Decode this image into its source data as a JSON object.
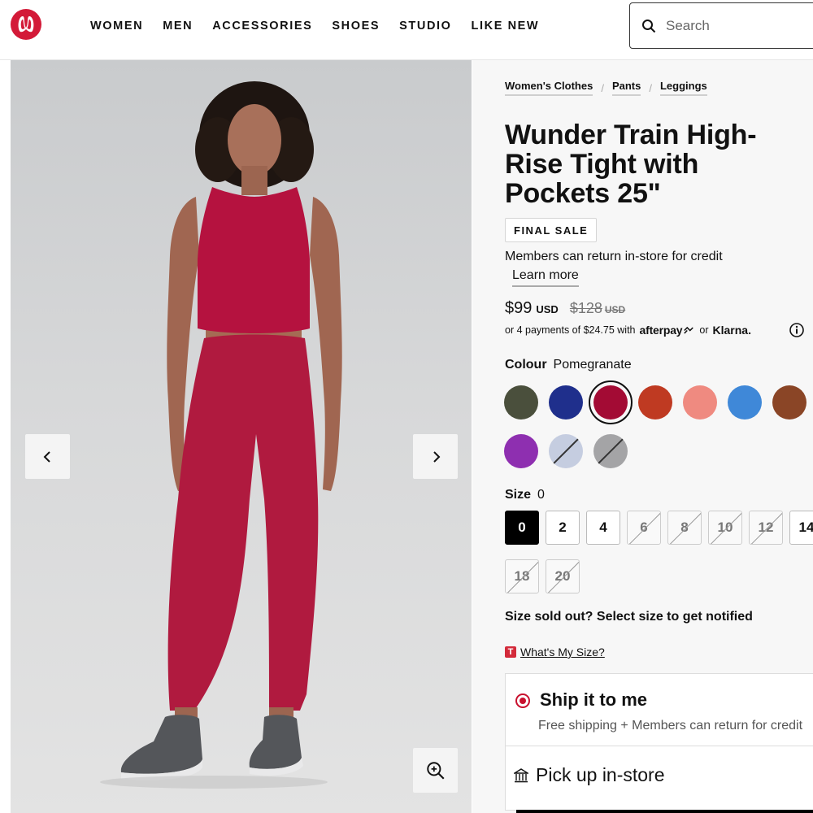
{
  "header": {
    "nav": [
      "WOMEN",
      "MEN",
      "ACCESSORIES",
      "SHOES",
      "STUDIO",
      "LIKE NEW"
    ],
    "search_placeholder": "Search"
  },
  "colors": {
    "brand": "#d31a38",
    "selected_size_bg": "#000000",
    "radio_accent": "#c8102e",
    "product": "#b3123e"
  },
  "product": {
    "breadcrumbs": [
      "Women's Clothes",
      "Pants",
      "Leggings"
    ],
    "title": "Wunder Train High-Rise Tight with Pockets 25\"",
    "badge": "FINAL SALE",
    "return_note": "Members can return in-store for credit",
    "learn_more": "Learn more",
    "price": "$99",
    "price_unit": "USD",
    "old_price": "$128",
    "old_price_unit": "USD",
    "installments_text": "or 4 payments of $24.75 with",
    "afterpay": "afterpay",
    "or_text": "or",
    "klarna": "Klarna."
  },
  "colour": {
    "label": "Colour",
    "selected": "Pomegranate",
    "swatches": [
      {
        "color": "#4a4f3c",
        "unavailable": false,
        "selected": false
      },
      {
        "color": "#1f2f8c",
        "unavailable": false,
        "selected": false
      },
      {
        "color": "#a30b34",
        "unavailable": false,
        "selected": true
      },
      {
        "color": "#bf3a22",
        "unavailable": false,
        "selected": false
      },
      {
        "color": "#ef8a80",
        "unavailable": false,
        "selected": false
      },
      {
        "color": "#3f88d8",
        "unavailable": false,
        "selected": false
      },
      {
        "color": "#8a4526",
        "unavailable": false,
        "selected": false
      },
      {
        "color": "#8e2fb0",
        "unavailable": false,
        "selected": false
      },
      {
        "color": "#c5cde0",
        "unavailable": true,
        "selected": false
      },
      {
        "color": "#a4a4a6",
        "unavailable": true,
        "selected": false
      }
    ]
  },
  "size": {
    "label": "Size",
    "selected": "0",
    "options": [
      {
        "label": "0",
        "sold_out": false,
        "selected": true
      },
      {
        "label": "2",
        "sold_out": false,
        "selected": false
      },
      {
        "label": "4",
        "sold_out": false,
        "selected": false
      },
      {
        "label": "6",
        "sold_out": true,
        "selected": false
      },
      {
        "label": "8",
        "sold_out": true,
        "selected": false
      },
      {
        "label": "10",
        "sold_out": true,
        "selected": false
      },
      {
        "label": "12",
        "sold_out": true,
        "selected": false
      },
      {
        "label": "14",
        "sold_out": false,
        "selected": false
      },
      {
        "label": "18",
        "sold_out": true,
        "selected": false
      },
      {
        "label": "20",
        "sold_out": true,
        "selected": false
      }
    ],
    "sold_out_note": "Size sold out? Select size to get notified",
    "whats_my_size": "What's My Size?",
    "whats_my_size_badge": "T"
  },
  "fulfillment": {
    "ship_title": "Ship it to me",
    "ship_sub": "Free shipping + Members can return for credit",
    "pickup_title": "Pick up in-store"
  }
}
